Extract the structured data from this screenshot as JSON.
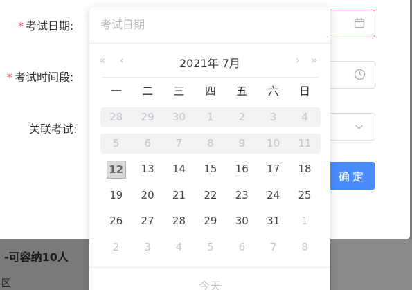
{
  "form": {
    "required_mark": "*",
    "exam_date_label": "考试日期:",
    "exam_time_label": "考试时间段:",
    "related_exam_label": "关联考试:",
    "confirm_label": "确定"
  },
  "backdrop": {
    "capacity_text": "-可容纳10人",
    "region_text": "区"
  },
  "picker": {
    "placeholder": "考试日期",
    "month_title": "2021年 7月",
    "prev_year": "«",
    "prev_month": "‹",
    "next_month": "›",
    "next_year": "»",
    "weekdays": [
      "一",
      "二",
      "三",
      "四",
      "五",
      "六",
      "日"
    ],
    "weeks": [
      [
        {
          "d": "28",
          "muted": true
        },
        {
          "d": "29",
          "muted": true
        },
        {
          "d": "30",
          "muted": true
        },
        {
          "d": "1",
          "muted": true
        },
        {
          "d": "2",
          "muted": true
        },
        {
          "d": "3",
          "muted": true
        },
        {
          "d": "4",
          "muted": true
        }
      ],
      [
        {
          "d": "5",
          "muted": true
        },
        {
          "d": "6",
          "muted": true
        },
        {
          "d": "7",
          "muted": true
        },
        {
          "d": "8",
          "muted": true
        },
        {
          "d": "9",
          "muted": true
        },
        {
          "d": "10",
          "muted": true
        },
        {
          "d": "11",
          "muted": true
        }
      ],
      [
        {
          "d": "12",
          "muted": false,
          "today": true
        },
        {
          "d": "13",
          "muted": false
        },
        {
          "d": "14",
          "muted": false
        },
        {
          "d": "15",
          "muted": false
        },
        {
          "d": "16",
          "muted": false
        },
        {
          "d": "17",
          "muted": false
        },
        {
          "d": "18",
          "muted": false
        }
      ],
      [
        {
          "d": "19",
          "muted": false
        },
        {
          "d": "20",
          "muted": false
        },
        {
          "d": "21",
          "muted": false
        },
        {
          "d": "22",
          "muted": false
        },
        {
          "d": "23",
          "muted": false
        },
        {
          "d": "24",
          "muted": false
        },
        {
          "d": "25",
          "muted": false
        }
      ],
      [
        {
          "d": "26",
          "muted": false
        },
        {
          "d": "27",
          "muted": false
        },
        {
          "d": "28",
          "muted": false
        },
        {
          "d": "29",
          "muted": false
        },
        {
          "d": "30",
          "muted": false
        },
        {
          "d": "31",
          "muted": false
        },
        {
          "d": "1",
          "muted": true
        }
      ],
      [
        {
          "d": "2",
          "muted": true
        },
        {
          "d": "3",
          "muted": true
        },
        {
          "d": "4",
          "muted": true
        },
        {
          "d": "5",
          "muted": true
        },
        {
          "d": "6",
          "muted": true
        },
        {
          "d": "7",
          "muted": true
        },
        {
          "d": "8",
          "muted": true
        }
      ]
    ],
    "shaded_weeks": [
      0,
      1
    ],
    "footer_today": "今天"
  },
  "colors": {
    "required": "#e84a4a",
    "primary": "#4a8cff",
    "muted_text": "#c0c4cc"
  },
  "icons": {
    "date_field": "calendar-icon",
    "time_field": "clock-icon",
    "select_field": "chevron-down-icon"
  }
}
